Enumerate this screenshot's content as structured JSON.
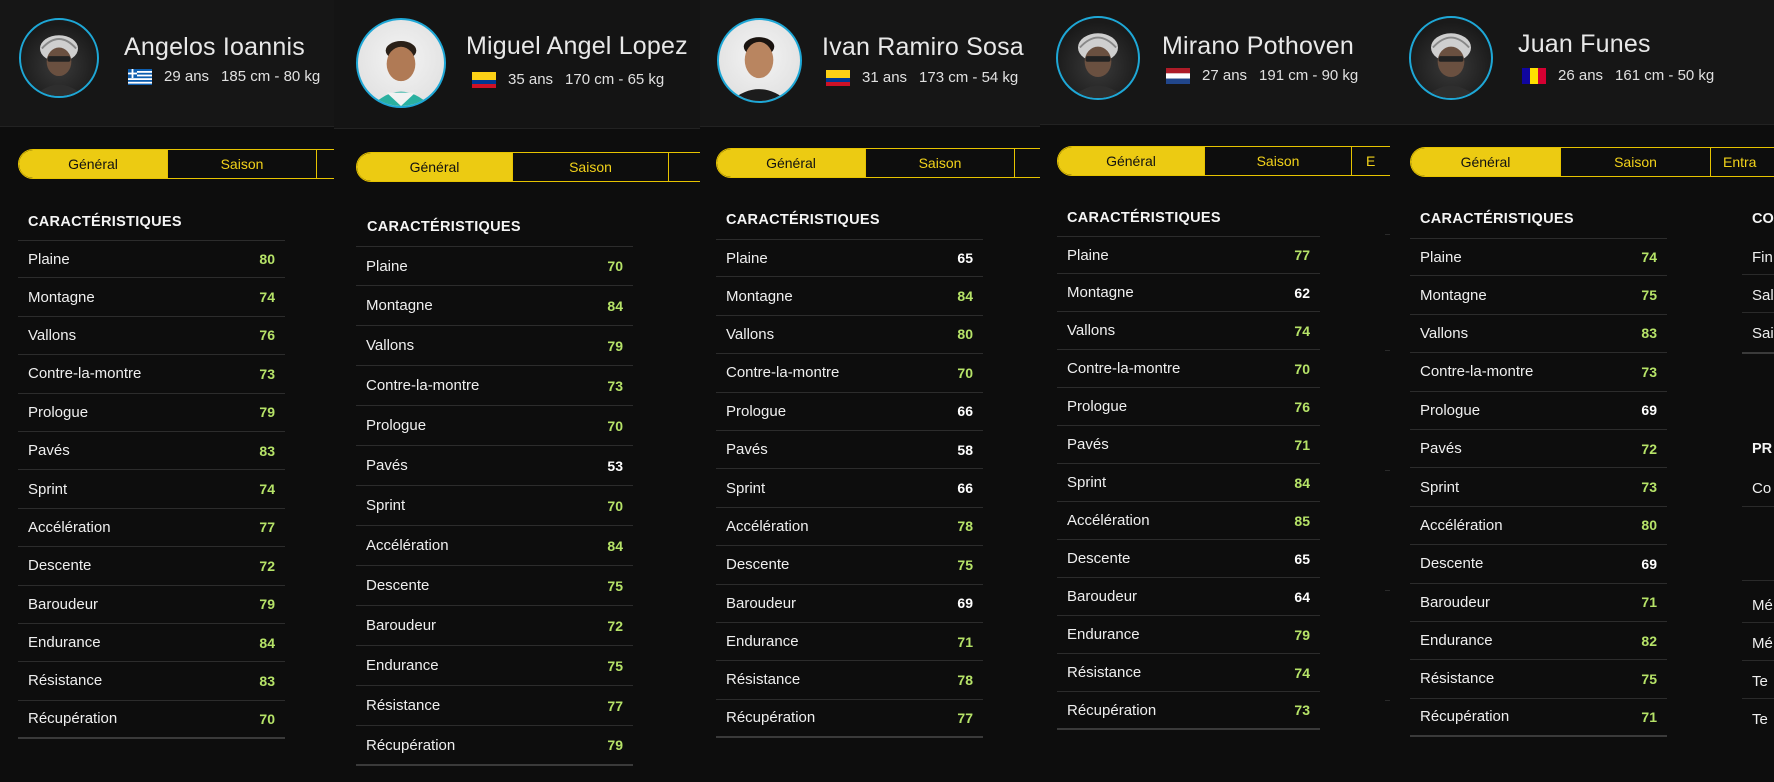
{
  "tabs": {
    "general": "Général",
    "saison": "Saison",
    "entrainement": "Entra",
    "entrainement_short": "E"
  },
  "section_title": "CARACTÉRISTIQUES",
  "riders": [
    {
      "name": "Angelos Ioannis",
      "flag": "greece",
      "age": "29 ans",
      "size": "185 cm - 80 kg",
      "avatar": "generic-helmet-avatar",
      "stats": [
        {
          "label": "Plaine",
          "value": "80"
        },
        {
          "label": "Montagne",
          "value": "74"
        },
        {
          "label": "Vallons",
          "value": "76"
        },
        {
          "label": "Contre-la-montre",
          "value": "73"
        },
        {
          "label": "Prologue",
          "value": "79"
        },
        {
          "label": "Pavés",
          "value": "83"
        },
        {
          "label": "Sprint",
          "value": "74"
        },
        {
          "label": "Accélération",
          "value": "77"
        },
        {
          "label": "Descente",
          "value": "72"
        },
        {
          "label": "Baroudeur",
          "value": "79"
        },
        {
          "label": "Endurance",
          "value": "84"
        },
        {
          "label": "Résistance",
          "value": "83"
        },
        {
          "label": "Récupération",
          "value": "70"
        }
      ],
      "highlight": [
        true,
        true,
        true,
        true,
        true,
        true,
        true,
        true,
        true,
        true,
        true,
        true,
        true
      ]
    },
    {
      "name": "Miguel Angel Lopez",
      "flag": "colombia",
      "age": "35 ans",
      "size": "170 cm - 65 kg",
      "avatar": "rider-portrait",
      "stats": [
        {
          "label": "Plaine",
          "value": "70"
        },
        {
          "label": "Montagne",
          "value": "84"
        },
        {
          "label": "Vallons",
          "value": "79"
        },
        {
          "label": "Contre-la-montre",
          "value": "73"
        },
        {
          "label": "Prologue",
          "value": "70"
        },
        {
          "label": "Pavés",
          "value": "53"
        },
        {
          "label": "Sprint",
          "value": "70"
        },
        {
          "label": "Accélération",
          "value": "84"
        },
        {
          "label": "Descente",
          "value": "75"
        },
        {
          "label": "Baroudeur",
          "value": "72"
        },
        {
          "label": "Endurance",
          "value": "75"
        },
        {
          "label": "Résistance",
          "value": "77"
        },
        {
          "label": "Récupération",
          "value": "79"
        }
      ],
      "highlight": [
        true,
        true,
        true,
        true,
        true,
        false,
        true,
        true,
        true,
        true,
        true,
        true,
        true
      ]
    },
    {
      "name": "Ivan Ramiro Sosa",
      "flag": "colombia",
      "age": "31 ans",
      "size": "173 cm - 54 kg",
      "avatar": "rider-portrait",
      "stats": [
        {
          "label": "Plaine",
          "value": "65"
        },
        {
          "label": "Montagne",
          "value": "84"
        },
        {
          "label": "Vallons",
          "value": "80"
        },
        {
          "label": "Contre-la-montre",
          "value": "70"
        },
        {
          "label": "Prologue",
          "value": "66"
        },
        {
          "label": "Pavés",
          "value": "58"
        },
        {
          "label": "Sprint",
          "value": "66"
        },
        {
          "label": "Accélération",
          "value": "78"
        },
        {
          "label": "Descente",
          "value": "75"
        },
        {
          "label": "Baroudeur",
          "value": "69"
        },
        {
          "label": "Endurance",
          "value": "71"
        },
        {
          "label": "Résistance",
          "value": "78"
        },
        {
          "label": "Récupération",
          "value": "77"
        }
      ],
      "highlight": [
        false,
        true,
        true,
        true,
        false,
        false,
        false,
        true,
        true,
        false,
        true,
        true,
        true
      ]
    },
    {
      "name": "Mirano Pothoven",
      "flag": "netherlands",
      "age": "27 ans",
      "size": "191 cm - 90 kg",
      "avatar": "generic-helmet-avatar",
      "stats": [
        {
          "label": "Plaine",
          "value": "77"
        },
        {
          "label": "Montagne",
          "value": "62"
        },
        {
          "label": "Vallons",
          "value": "74"
        },
        {
          "label": "Contre-la-montre",
          "value": "70"
        },
        {
          "label": "Prologue",
          "value": "76"
        },
        {
          "label": "Pavés",
          "value": "71"
        },
        {
          "label": "Sprint",
          "value": "84"
        },
        {
          "label": "Accélération",
          "value": "85"
        },
        {
          "label": "Descente",
          "value": "65"
        },
        {
          "label": "Baroudeur",
          "value": "64"
        },
        {
          "label": "Endurance",
          "value": "79"
        },
        {
          "label": "Résistance",
          "value": "74"
        },
        {
          "label": "Récupération",
          "value": "73"
        }
      ],
      "highlight": [
        true,
        false,
        true,
        true,
        true,
        true,
        true,
        true,
        false,
        false,
        true,
        true,
        true
      ]
    },
    {
      "name": "Juan Funes",
      "flag": "andorra",
      "age": "26 ans",
      "size": "161 cm - 50 kg",
      "avatar": "generic-helmet-avatar",
      "stats": [
        {
          "label": "Plaine",
          "value": "74"
        },
        {
          "label": "Montagne",
          "value": "75"
        },
        {
          "label": "Vallons",
          "value": "83"
        },
        {
          "label": "Contre-la-montre",
          "value": "73"
        },
        {
          "label": "Prologue",
          "value": "69"
        },
        {
          "label": "Pavés",
          "value": "72"
        },
        {
          "label": "Sprint",
          "value": "73"
        },
        {
          "label": "Accélération",
          "value": "80"
        },
        {
          "label": "Descente",
          "value": "69"
        },
        {
          "label": "Baroudeur",
          "value": "71"
        },
        {
          "label": "Endurance",
          "value": "82"
        },
        {
          "label": "Résistance",
          "value": "75"
        },
        {
          "label": "Récupération",
          "value": "71"
        }
      ],
      "highlight": [
        true,
        true,
        true,
        true,
        false,
        true,
        true,
        true,
        false,
        true,
        true,
        true,
        true
      ]
    }
  ],
  "clipped_column": {
    "title_top": "CO",
    "items_top": [
      "Fin",
      "Sal",
      "Sai"
    ],
    "title_bottom": "PR",
    "items_bottom": [
      "Co",
      "Mé",
      "Mé",
      "Te",
      "Te"
    ]
  },
  "colors": {
    "accent": "#eccb12",
    "avatar_ring": "#1ea7d6",
    "value_high": "#b6e368",
    "value_normal": "#ffffff"
  }
}
